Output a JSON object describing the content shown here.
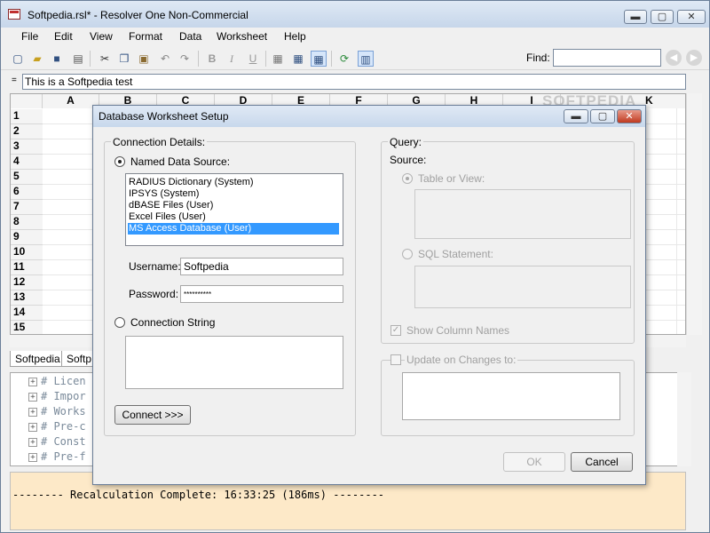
{
  "window": {
    "title": "Softpedia.rsl* - Resolver One Non-Commercial",
    "minimize_glyph": "▬",
    "maximize_glyph": "▢",
    "close_glyph": "✕"
  },
  "menu": [
    "File",
    "Edit",
    "View",
    "Format",
    "Data",
    "Worksheet",
    "Help"
  ],
  "toolbar": {
    "icons": [
      "new-icon",
      "open-icon",
      "save-icon",
      "print-icon",
      "cut-icon",
      "copy-icon",
      "paste-icon",
      "undo-icon",
      "redo-icon",
      "bold-icon",
      "italic-icon",
      "underline-icon",
      "grid-icon",
      "table-icon",
      "table-grid-icon",
      "recalc-icon",
      "chart-icon"
    ],
    "bold": "B",
    "italic": "I",
    "underline": "U",
    "find_label": "Find:",
    "find_value": "",
    "back_glyph": "◀",
    "forward_glyph": "▶"
  },
  "formula_bar": {
    "prefix": "=",
    "value": "This is a Softpedia test"
  },
  "grid": {
    "columns": [
      "A",
      "B",
      "C",
      "D",
      "E",
      "F",
      "G",
      "H",
      "I",
      "K"
    ],
    "rows": [
      "1",
      "2",
      "3",
      "4",
      "5",
      "6",
      "7",
      "8",
      "9",
      "10",
      "11",
      "12",
      "13",
      "14",
      "15"
    ]
  },
  "sheet_tabs": [
    "Softpedia",
    "Softp"
  ],
  "code_lines": [
    "# Licen",
    "# Impor",
    "# Works",
    "# Pre-c",
    "# Const",
    "# Pre-f"
  ],
  "output": {
    "text": "-------- Recalculation Complete: 16:33:25 (186ms) --------"
  },
  "watermark": "SOFTPEDIA",
  "dialog": {
    "title": "Database Worksheet Setup",
    "connection": {
      "group_label": "Connection Details:",
      "named_source_label": "Named Data Source:",
      "sources": [
        "RADIUS Dictionary (System)",
        "IPSYS (System)",
        "dBASE Files (User)",
        "Excel Files (User)",
        "MS Access Database (User)"
      ],
      "selected_source": "MS Access Database (User)",
      "username_label": "Username:",
      "username_value": "Softpedia",
      "password_label": "Password:",
      "password_value": "**********",
      "connection_string_label": "Connection String",
      "connection_string_value": "",
      "connect_button": "Connect >>>"
    },
    "query": {
      "group_label": "Query:",
      "source_label": "Source:",
      "table_label": "Table or View:",
      "sql_label": "SQL Statement:",
      "show_columns_label": "Show Column Names"
    },
    "update": {
      "label": "Update on Changes to:"
    },
    "ok_button": "OK",
    "cancel_button": "Cancel"
  }
}
